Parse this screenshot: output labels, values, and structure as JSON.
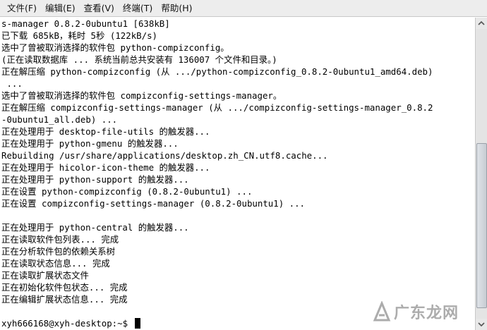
{
  "menubar": {
    "items": [
      {
        "label": "文件(F)"
      },
      {
        "label": "编辑(E)"
      },
      {
        "label": "查看(V)"
      },
      {
        "label": "终端(T)"
      },
      {
        "label": "帮助(H)"
      }
    ]
  },
  "terminal": {
    "lines": [
      "s-manager 0.8.2-0ubuntu1 [638kB]",
      "已下载 685kB，耗时 5秒 (122kB/s)",
      "选中了曾被取消选择的软件包 python-compizconfig。",
      "(正在读取数据库 ... 系统当前总共安装有 136007 个文件和目录。)",
      "正在解压缩 python-compizconfig (从 .../python-compizconfig_0.8.2-0ubuntu1_amd64.deb)",
      " ...",
      "选中了曾被取消选择的软件包 compizconfig-settings-manager。",
      "正在解压缩 compizconfig-settings-manager (从 .../compizconfig-settings-manager_0.8.2",
      "-0ubuntu1_all.deb) ...",
      "正在处理用于 desktop-file-utils 的触发器...",
      "正在处理用于 python-gmenu 的触发器...",
      "Rebuilding /usr/share/applications/desktop.zh_CN.utf8.cache...",
      "正在处理用于 hicolor-icon-theme 的触发器...",
      "正在处理用于 python-support 的触发器...",
      "正在设置 python-compizconfig (0.8.2-0ubuntu1) ...",
      "正在设置 compizconfig-settings-manager (0.8.2-0ubuntu1) ...",
      "",
      "正在处理用于 python-central 的触发器...",
      "正在读取软件包列表... 完成",
      "正在分析软件包的依赖关系树",
      "正在读取状态信息... 完成",
      "正在读取扩展状态文件",
      "正在初始化软件包状态... 完成",
      "正在编辑扩展状态信息... 完成"
    ],
    "prompt": "xyh666168@xyh-desktop:~$ "
  },
  "watermark": {
    "text": "广东龙网"
  }
}
